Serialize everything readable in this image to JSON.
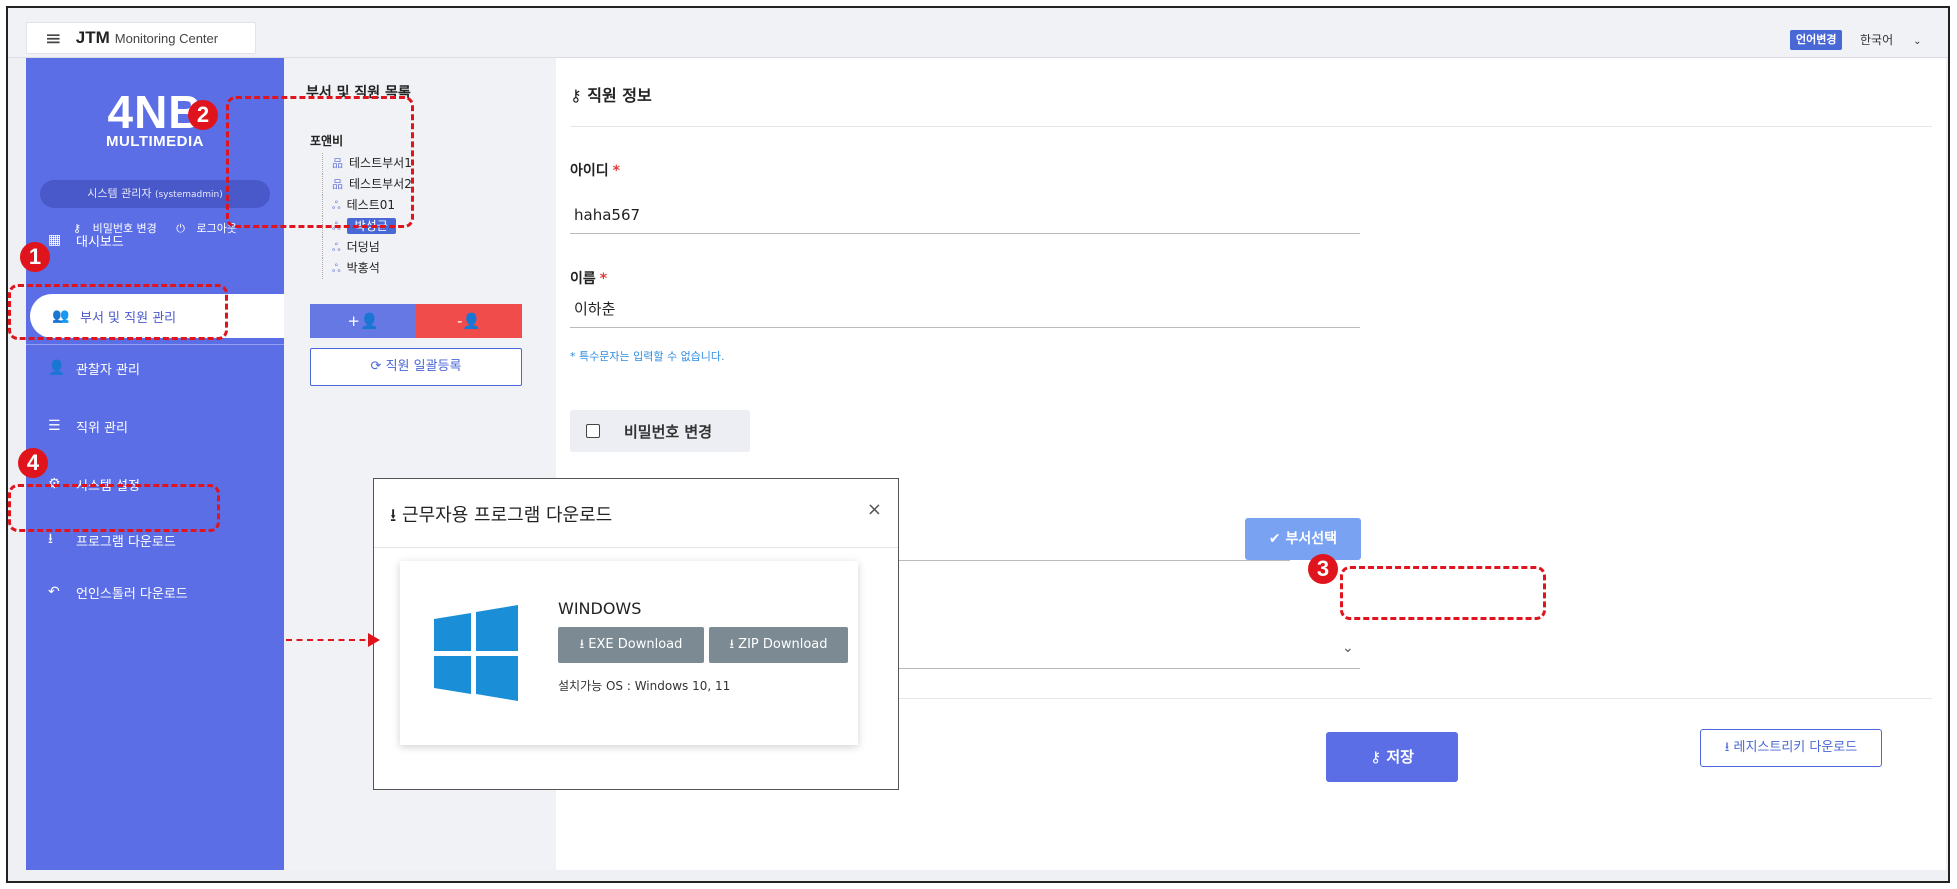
{
  "header": {
    "app_title_strong": "JTM",
    "app_title_sub": "Monitoring Center",
    "lang_button": "언어변경",
    "lang_selected": "한국어"
  },
  "sidebar": {
    "logo_big": "4NB",
    "logo_small": "MULTIMEDIA",
    "admin_label": "시스템 관리자",
    "admin_id": "(systemadmin)",
    "change_password": "비밀번호 변경",
    "logout": "로그아웃",
    "items": [
      {
        "label": "대시보드",
        "icon": "dashboard-icon"
      },
      {
        "label": "부서 및 직원 관리",
        "icon": "users-icon"
      },
      {
        "label": "관찰자 관리",
        "icon": "user-gear-icon"
      },
      {
        "label": "직위 관리",
        "icon": "list-icon"
      },
      {
        "label": "시스템 설정",
        "icon": "gear-icon"
      },
      {
        "label": "프로그램 다운로드",
        "icon": "download-icon"
      },
      {
        "label": "언인스톨러 다운로드",
        "icon": "undo-icon"
      }
    ]
  },
  "tree_panel": {
    "title": "부서 및 직원 목록",
    "root": "포앤비",
    "nodes": [
      {
        "label": "테스트부서1",
        "type": "dept"
      },
      {
        "label": "테스트부서2",
        "type": "dept"
      },
      {
        "label": "테스트01",
        "type": "user"
      },
      {
        "label": "박성균",
        "type": "user",
        "selected": true
      },
      {
        "label": "더덩넘",
        "type": "user"
      },
      {
        "label": "박홍석",
        "type": "user"
      }
    ],
    "add_button": "+👤",
    "remove_button": "-👤",
    "bulk_register": "직원 일괄등록"
  },
  "main": {
    "title": "직원 정보",
    "id_label": "아이디",
    "id_value": "haha567",
    "name_label": "이름",
    "name_value": "이하춘",
    "name_hint": "* 특수문자는 입력할 수 없습니다.",
    "change_password_label": "비밀번호 변경",
    "dept_select_button": "부서선택",
    "save_button": "저장",
    "registry_button": "레지스트리키 다운로드"
  },
  "modal": {
    "title": "근무자용 프로그램 다운로드",
    "close": "×",
    "os_name": "WINDOWS",
    "exe_button": "EXE Download",
    "zip_button": "ZIP Download",
    "os_note": "설치가능 OS : Windows 10, 11"
  },
  "annotations": [
    "1",
    "2",
    "3",
    "4"
  ],
  "colors": {
    "sidebar": "#5b6ee6",
    "accent": "#4a67d6",
    "danger": "#f04c4c",
    "annotation": "#e0141c",
    "windows_blue": "#1a8fd8"
  }
}
